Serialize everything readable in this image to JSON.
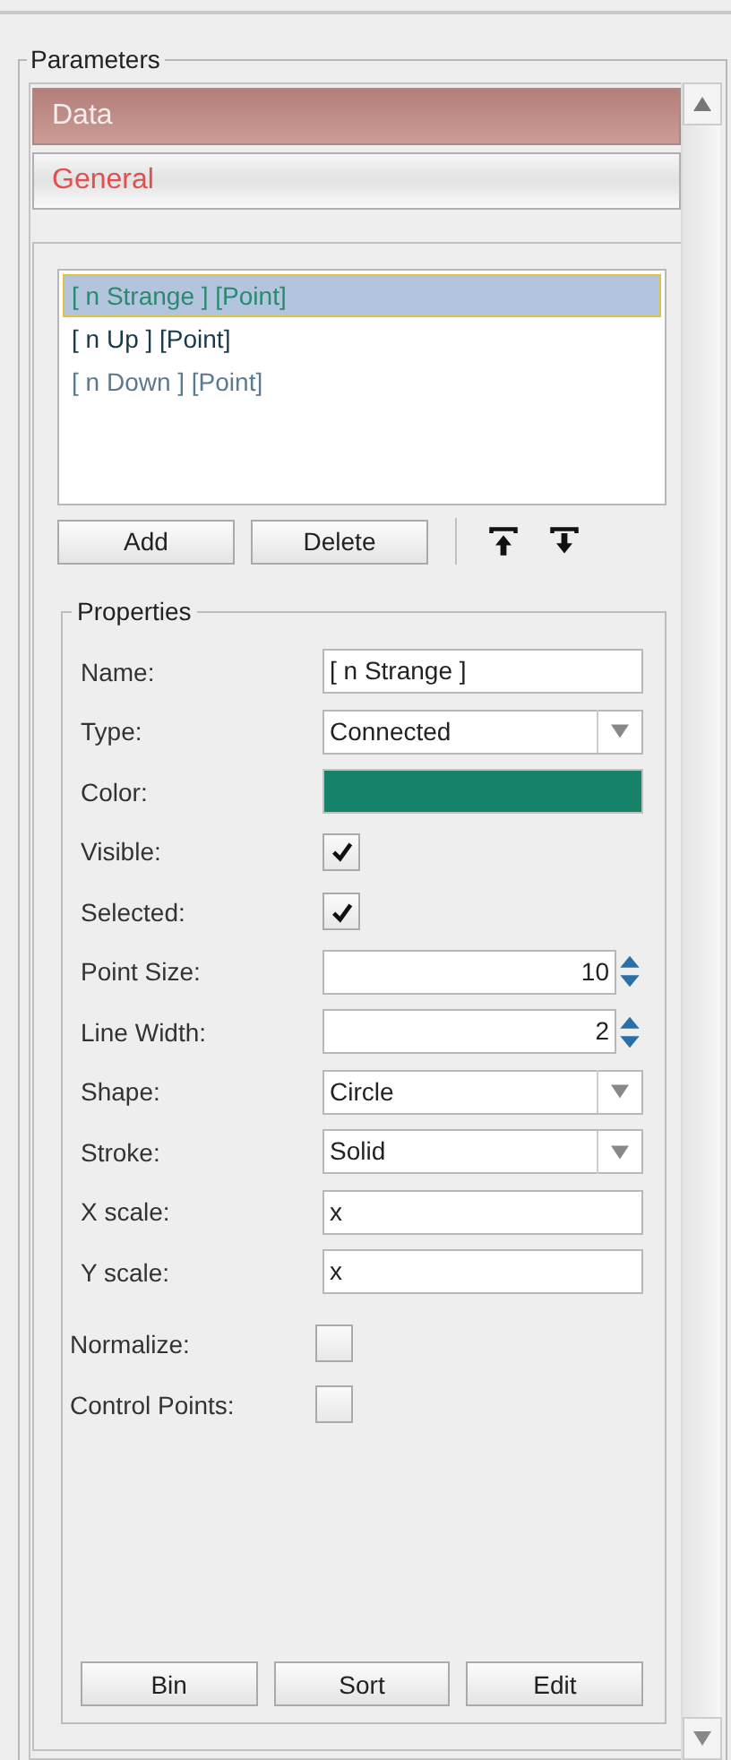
{
  "panel": {
    "title": "Parameters"
  },
  "sections": [
    {
      "label": "Data",
      "expanded": true
    },
    {
      "label": "General",
      "expanded": false
    }
  ],
  "series_list": [
    {
      "label": "[ n Strange ] [Point]",
      "selected": true,
      "color": "#2a8a6e"
    },
    {
      "label": "[ n Up ] [Point]",
      "selected": false,
      "color": "#1a3a4a"
    },
    {
      "label": "[ n Down ] [Point]",
      "selected": false,
      "color": "#5a7a90"
    }
  ],
  "list_buttons": [
    "Add",
    "Delete"
  ],
  "properties": {
    "title": "Properties",
    "rows": [
      {
        "kind": "text",
        "label": "Name:",
        "value": "[ n Strange ]"
      },
      {
        "kind": "combo",
        "label": "Type:",
        "value": "Connected"
      },
      {
        "kind": "color",
        "label": "Color:",
        "color": "#17826a"
      },
      {
        "kind": "checkbox",
        "label": "Visible:",
        "checked": true
      },
      {
        "kind": "checkbox",
        "label": "Selected:",
        "checked": true
      },
      {
        "kind": "spinner",
        "label": "Point Size:",
        "value": "10"
      },
      {
        "kind": "spinner",
        "label": "Line Width:",
        "value": "2"
      },
      {
        "kind": "combo",
        "label": "Shape:",
        "value": "Circle"
      },
      {
        "kind": "combo",
        "label": "Stroke:",
        "value": "Solid"
      },
      {
        "kind": "text",
        "label": "X scale:",
        "value": "x"
      },
      {
        "kind": "text",
        "label": "Y scale:",
        "value": "x"
      }
    ],
    "options": [
      {
        "label": "Normalize:",
        "checked": false
      },
      {
        "label": "Control Points:",
        "checked": false
      }
    ],
    "buttons": [
      "Bin",
      "Sort",
      "Edit"
    ]
  }
}
